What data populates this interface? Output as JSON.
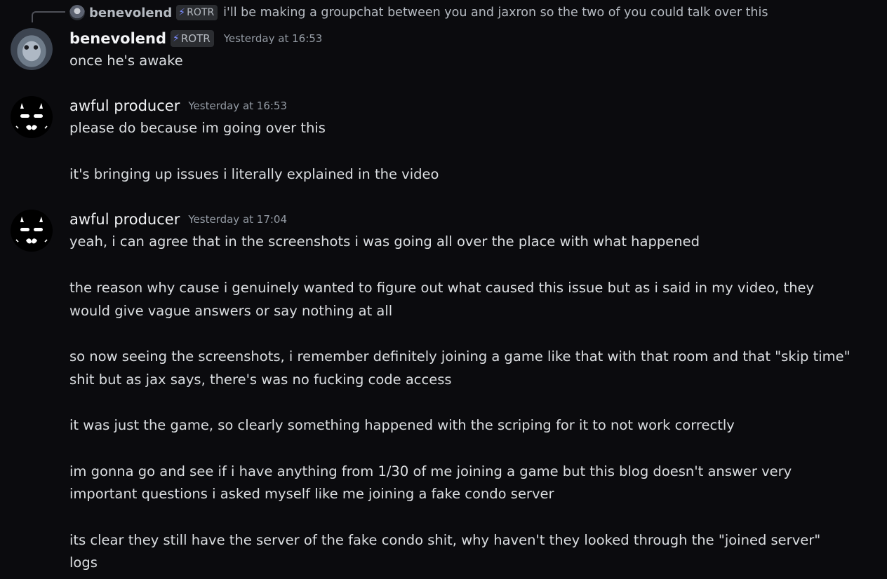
{
  "reply": {
    "author": "benevolend",
    "tag": "ROTR",
    "text": "i'll be making a groupchat between you and jaxron so the two of you could talk over this"
  },
  "messages": [
    {
      "author": "benevolend",
      "tag": "ROTR",
      "timestamp": "Yesterday at 16:53",
      "avatar_icon": "owl-avatar-icon",
      "lines": [
        "once he's awake"
      ]
    },
    {
      "author": "awful producer",
      "timestamp": "Yesterday at 16:53",
      "avatar_icon": "masked-face-avatar-icon",
      "lines": [
        "please do because im going over this",
        "it's bringing up issues i literally explained in the video"
      ]
    },
    {
      "author": "awful producer",
      "timestamp": "Yesterday at 17:04",
      "avatar_icon": "masked-face-avatar-icon",
      "lines": [
        "yeah, i can agree that in the screenshots i was going all over the place with what happened",
        "the reason why cause i genuinely wanted to figure out what caused this issue but as i said in my video, they",
        "would give vague answers or say nothing at all",
        "so now seeing the screenshots, i remember definitely joining a game like that with that room and that \"skip time\"",
        "shit but as jax says, there's was no fucking code access",
        "it was just the game, so clearly something happened with the scriping for it to not work correctly",
        "im gonna go and see if i have anything from 1/30 of me joining a game but this blog doesn't answer very",
        "important questions i asked myself like me joining a fake condo server",
        "its clear they still have the server of the fake condo shit, why haven't they looked through the \"joined server\"",
        "logs"
      ]
    }
  ],
  "colors": {
    "background": "#0b0b0e",
    "text": "#dbdee1",
    "timestamp": "#949ba4",
    "tag_bolt": "#7b8cff"
  }
}
